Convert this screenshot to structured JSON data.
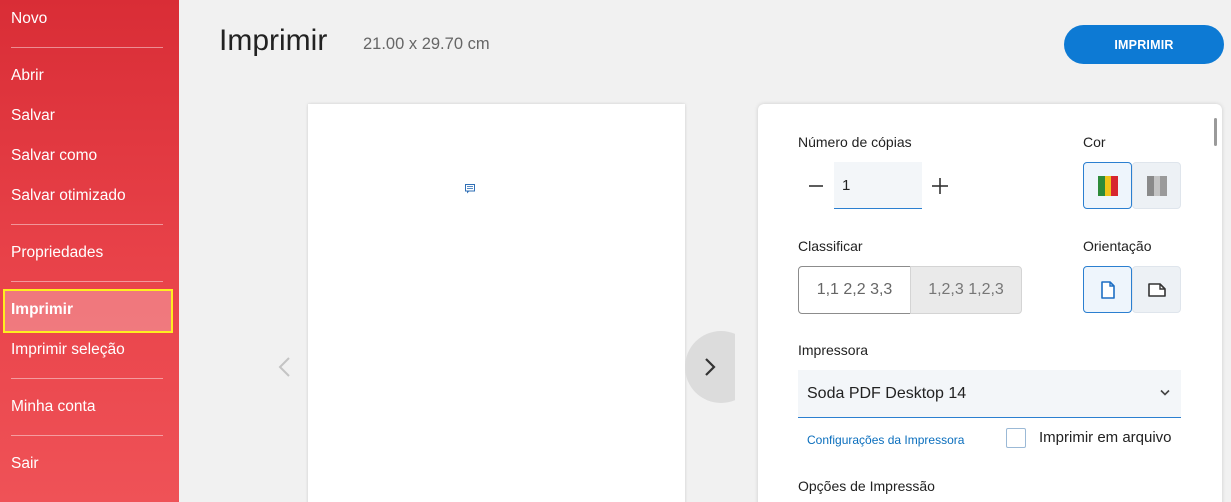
{
  "sidebar": {
    "items": [
      {
        "label": "Novo"
      },
      {
        "label": "Abrir"
      },
      {
        "label": "Salvar"
      },
      {
        "label": "Salvar como"
      },
      {
        "label": "Salvar otimizado"
      },
      {
        "label": "Propriedades"
      },
      {
        "label": "Imprimir"
      },
      {
        "label": "Imprimir seleção"
      },
      {
        "label": "Minha conta"
      },
      {
        "label": "Sair"
      }
    ],
    "active_item": "Imprimir"
  },
  "header": {
    "title": "Imprimir",
    "page_size": "21.00 x 29.70 cm",
    "print_button": "IMPRIMIR"
  },
  "settings": {
    "copies_label": "Número de cópias",
    "copies_value": "1",
    "color_label": "Cor",
    "color_mode": "color",
    "collate_label": "Classificar",
    "collate_options": [
      "1,1 2,2 3,3",
      "1,2,3 1,2,3"
    ],
    "collate_selected": "1,1 2,2 3,3",
    "orientation_label": "Orientação",
    "orientation_selected": "portrait",
    "printer_label": "Impressora",
    "printer_selected": "Soda PDF Desktop 14",
    "printer_settings_link": "Configurações da Impressora",
    "print_to_file_label": "Imprimir em arquivo",
    "print_to_file_checked": false,
    "options_label": "Opções de Impressão"
  },
  "colors": {
    "sidebar_top": "#d92d36",
    "sidebar_bottom": "#ef5257",
    "accent": "#0d7ad4",
    "highlight": "#ffee20"
  }
}
